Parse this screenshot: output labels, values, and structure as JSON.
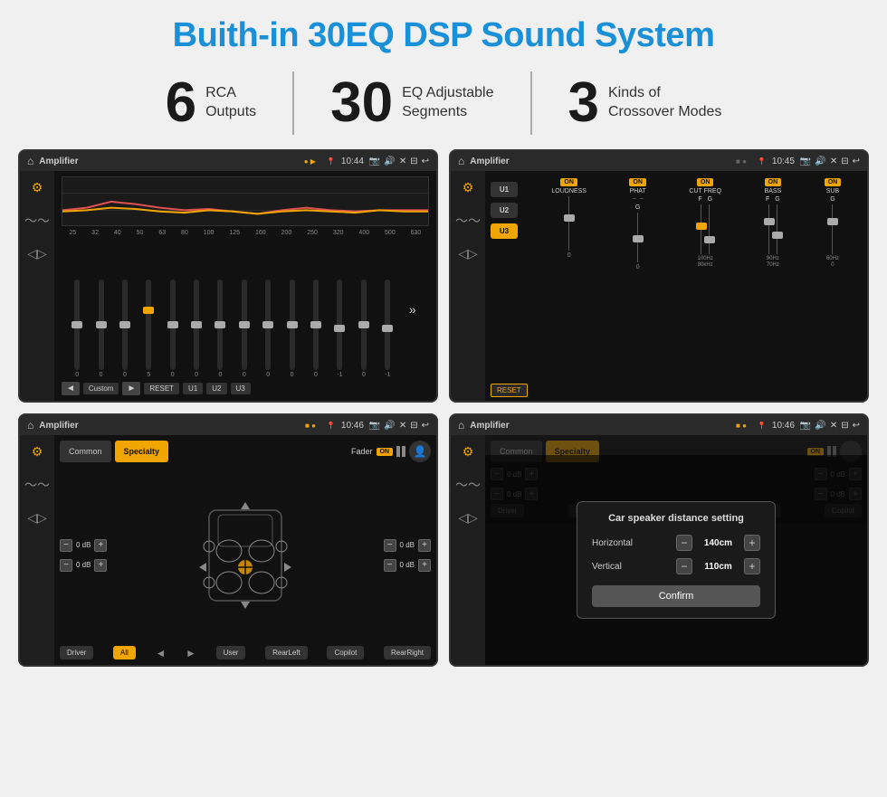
{
  "page": {
    "title": "Buith-in 30EQ DSP Sound System",
    "background": "#f0f0f0"
  },
  "stats": [
    {
      "number": "6",
      "label": "RCA\nOutputs"
    },
    {
      "number": "30",
      "label": "EQ Adjustable\nSegments"
    },
    {
      "number": "3",
      "label": "Kinds of\nCrossover Modes"
    }
  ],
  "screens": {
    "eq": {
      "header_title": "Amplifier",
      "time": "10:44",
      "freq_labels": [
        "25",
        "32",
        "40",
        "50",
        "63",
        "80",
        "100",
        "125",
        "160",
        "200",
        "250",
        "320",
        "400",
        "500",
        "630"
      ],
      "slider_values": [
        "0",
        "0",
        "0",
        "5",
        "0",
        "0",
        "0",
        "0",
        "0",
        "0",
        "0",
        "-1",
        "0",
        "-1"
      ],
      "bottom_buttons": [
        "Custom",
        "RESET",
        "U1",
        "U2",
        "U3"
      ]
    },
    "crossover": {
      "header_title": "Amplifier",
      "time": "10:45",
      "presets": [
        "U1",
        "U2",
        "U3"
      ],
      "active_preset": "U3",
      "controls": [
        "LOUDNESS",
        "PHAT",
        "CUT FREQ",
        "BASS",
        "SUB"
      ],
      "reset_label": "RESET"
    },
    "fader": {
      "header_title": "Amplifier",
      "time": "10:46",
      "tabs": [
        "Common",
        "Specialty"
      ],
      "active_tab": "Specialty",
      "fader_label": "Fader",
      "on_label": "ON",
      "bottom_buttons": [
        "Driver",
        "All",
        "User",
        "RearLeft",
        "RearRight",
        "Copilot"
      ],
      "vol_values": [
        "0 dB",
        "0 dB",
        "0 dB",
        "0 dB"
      ]
    },
    "distance": {
      "header_title": "Amplifier",
      "time": "10:46",
      "dialog_title": "Car speaker distance setting",
      "horizontal_label": "Horizontal",
      "horizontal_value": "140cm",
      "vertical_label": "Vertical",
      "vertical_value": "110cm",
      "confirm_label": "Confirm",
      "minus_icon": "−",
      "plus_icon": "+"
    }
  }
}
